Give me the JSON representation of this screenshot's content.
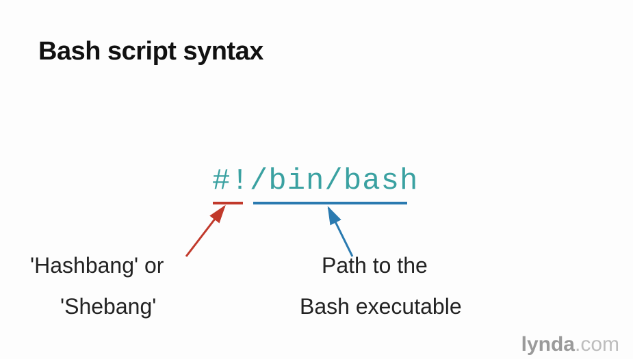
{
  "title": "Bash script syntax",
  "code": {
    "shebang": "#!",
    "path": "/bin/bash"
  },
  "labels": {
    "left_line1": "'Hashbang' or",
    "left_line2": "'Shebang'",
    "right_line1": "Path to the",
    "right_line2": "Bash executable"
  },
  "colors": {
    "red": "#c1392b",
    "blue": "#2a7ab0",
    "teal": "#3aa1a1"
  },
  "brand": {
    "name": "lynda",
    "suffix": ".com"
  }
}
